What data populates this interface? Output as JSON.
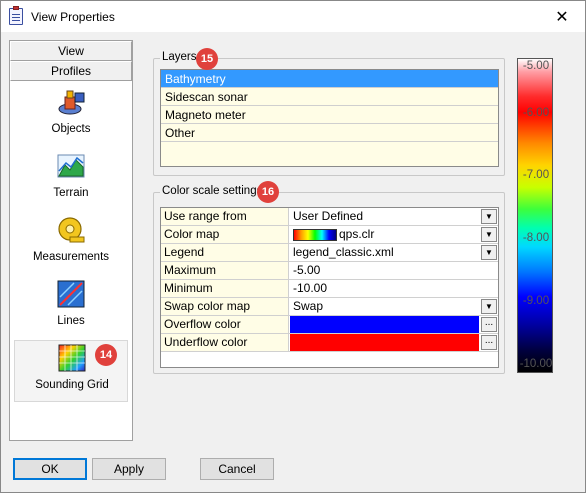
{
  "window": {
    "title": "View Properties",
    "close": "✕"
  },
  "nav": {
    "tabs": [
      "View",
      "Profiles"
    ],
    "items": [
      {
        "label": "Objects",
        "icon": "objects-icon"
      },
      {
        "label": "Terrain",
        "icon": "terrain-icon"
      },
      {
        "label": "Measurements",
        "icon": "measuring-tape-icon"
      },
      {
        "label": "Lines",
        "icon": "lines-icon"
      },
      {
        "label": "Sounding Grid",
        "icon": "sounding-grid-icon",
        "selected": true
      }
    ]
  },
  "badges": {
    "sounding_grid": "14",
    "layers": "15",
    "color_scale": "16"
  },
  "layers": {
    "title": "Layers",
    "items": [
      "Bathymetry",
      "Sidescan sonar",
      "Magneto meter",
      "Other"
    ],
    "selected": "Bathymetry"
  },
  "color_scale": {
    "title": "Color scale settings",
    "rows": [
      {
        "key": "Use range from",
        "value": "User Defined",
        "control": "dropdown"
      },
      {
        "key": "Color map",
        "value": "qps.clr",
        "control": "dropdown"
      },
      {
        "key": "Legend",
        "value": "legend_classic.xml",
        "control": "dropdown"
      },
      {
        "key": "Maximum",
        "value": "-5.00",
        "control": "text"
      },
      {
        "key": "Minimum",
        "value": "-10.00",
        "control": "text"
      },
      {
        "key": "Swap color map",
        "value": "Swap",
        "control": "dropdown"
      },
      {
        "key": "Overflow color",
        "value": "",
        "control": "color",
        "color": "#0000ff"
      },
      {
        "key": "Underflow color",
        "value": "",
        "control": "color",
        "color": "#ff0000"
      }
    ],
    "ellipsis": "..."
  },
  "legend": {
    "ticks": [
      "-5.00",
      "-6.00",
      "-7.00",
      "-8.00",
      "-9.00",
      "-10.00"
    ]
  },
  "buttons": {
    "ok": "OK",
    "apply": "Apply",
    "cancel": "Cancel"
  }
}
